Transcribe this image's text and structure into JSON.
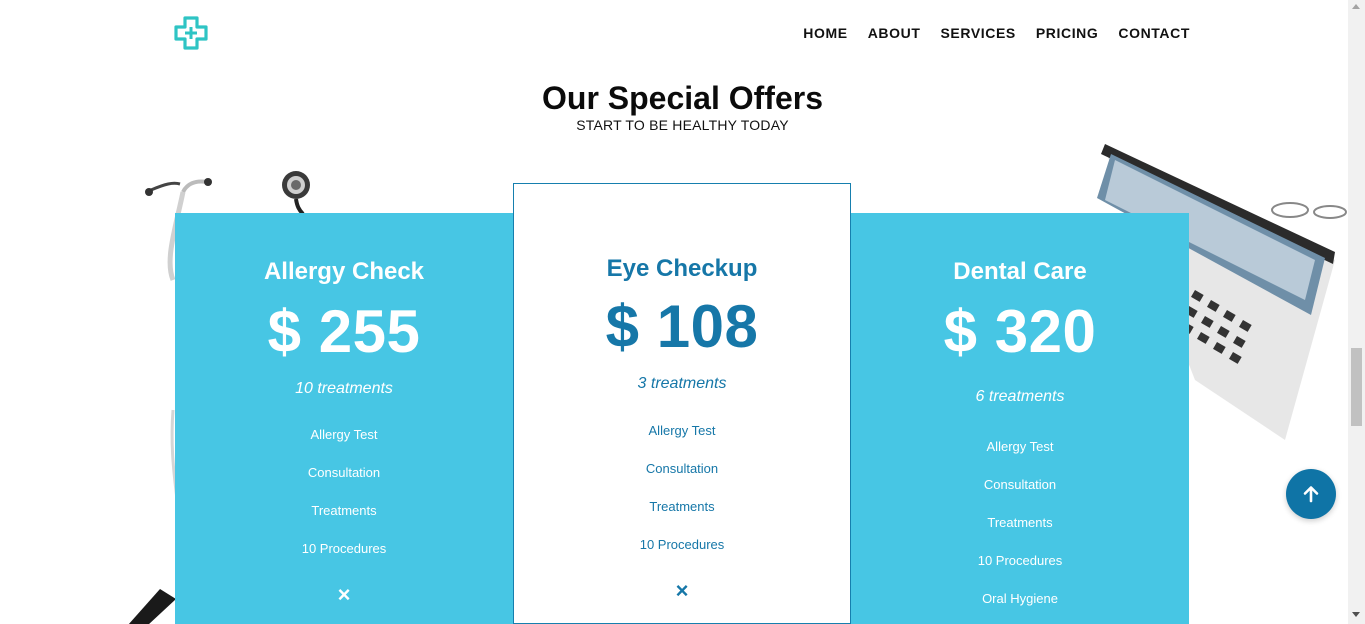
{
  "header": {
    "logo_icon": "medical-cross-icon",
    "nav": [
      "HOME",
      "ABOUT",
      "SERVICES",
      "PRICING",
      "CONTACT"
    ]
  },
  "section": {
    "title": "Our Special Offers",
    "subtitle": "START TO BE HEALTHY TODAY"
  },
  "plans": [
    {
      "name": "Allergy Check",
      "price": "$ 255",
      "treatments": "10 treatments",
      "features": [
        "Allergy Test",
        "Consultation",
        "Treatments",
        "10 Procedures"
      ],
      "extra_icon": "×"
    },
    {
      "name": "Eye Checkup",
      "price": "$ 108",
      "treatments": "3 treatments",
      "features": [
        "Allergy Test",
        "Consultation",
        "Treatments",
        "10 Procedures"
      ],
      "extra_icon": "×"
    },
    {
      "name": "Dental Care",
      "price": "$ 320",
      "treatments": "6 treatments",
      "features": [
        "Allergy Test",
        "Consultation",
        "Treatments",
        "10 Procedures",
        "Oral Hygiene"
      ]
    }
  ],
  "colors": {
    "card_blue": "#47c6e4",
    "accent": "#1677a8",
    "logo": "#2ec4c4"
  },
  "scroll_top_icon": "arrow-up-icon"
}
